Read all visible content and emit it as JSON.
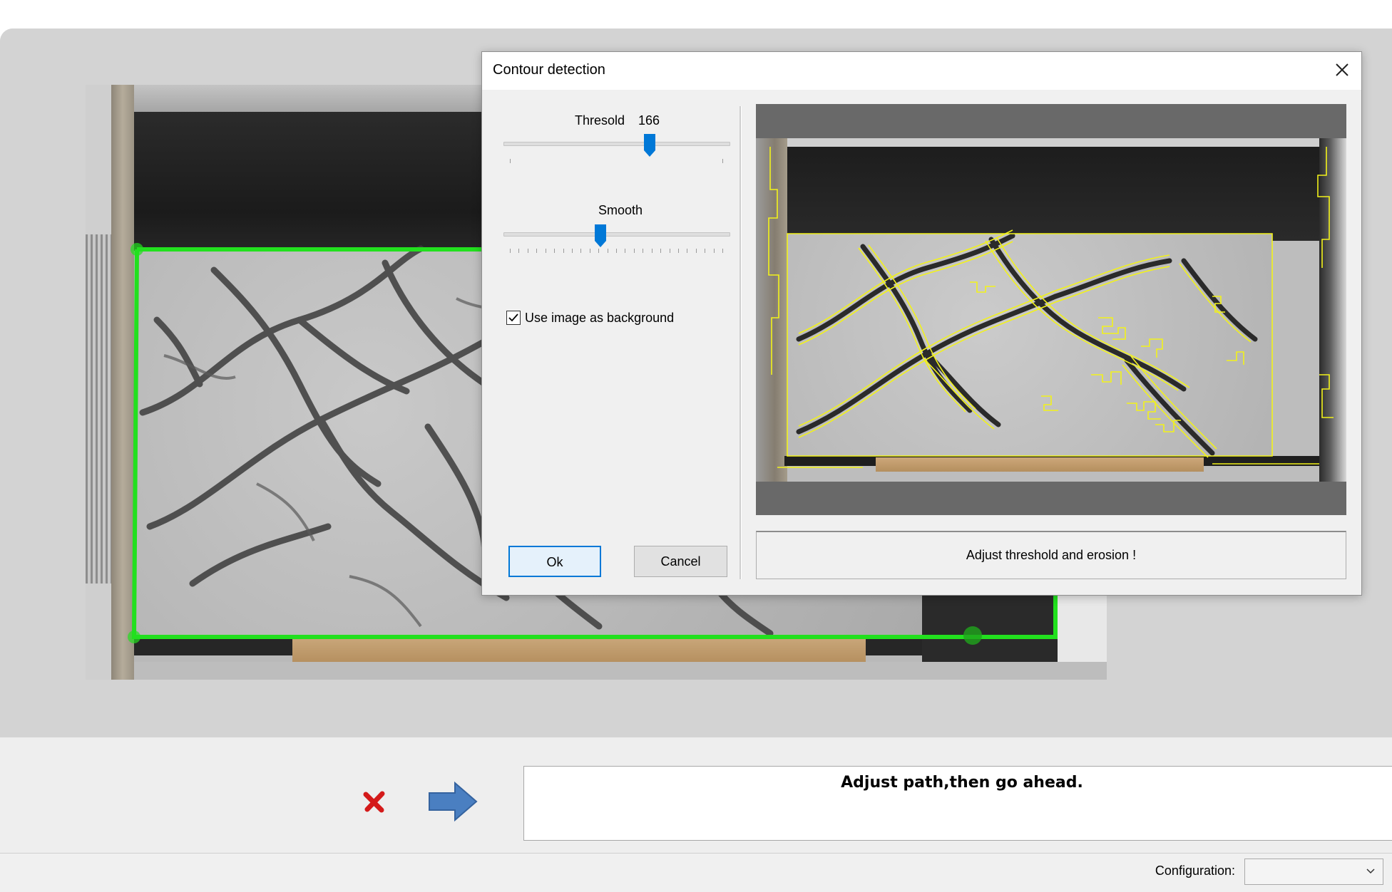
{
  "dialog": {
    "title": "Contour detection",
    "threshold": {
      "label": "Thresold",
      "value": "166",
      "level": 0.65
    },
    "smooth": {
      "label": "Smooth",
      "level": 0.43
    },
    "use_background": {
      "label": "Use image as background",
      "checked": true
    },
    "ok_label": "Ok",
    "cancel_label": "Cancel",
    "status_text": "Adjust threshold and erosion !"
  },
  "main": {
    "message": "Adjust path,then go ahead."
  },
  "status_bar": {
    "config_label": "Configuration:",
    "config_value": ""
  },
  "icons": {
    "close": "close-icon",
    "cancel": "red-x-icon",
    "next": "blue-arrow-right-icon",
    "dropdown": "chevron-down-icon"
  },
  "colors": {
    "path_outline": "#22e01e",
    "contour_lines": "#f2f21a",
    "accent": "#0078d7",
    "cancel_icon": "#d41a1a",
    "next_icon": "#4a7fc1"
  }
}
